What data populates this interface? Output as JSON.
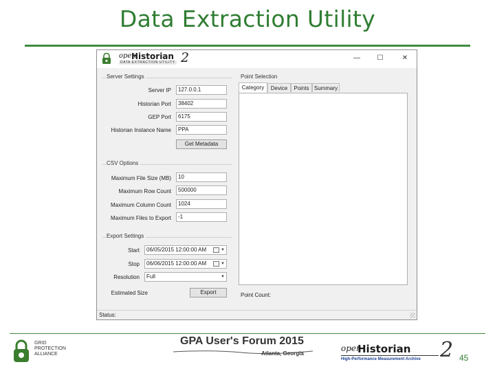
{
  "slide": {
    "title": "Data Extraction Utility",
    "page_number": "45"
  },
  "window": {
    "logo_open": "open",
    "logo_historian": "Historian",
    "logo_version": "2",
    "logo_subtitle": "DATA EXTRACTION UTILITY",
    "controls": {
      "minimize": "—",
      "maximize": "☐",
      "close": "✕"
    }
  },
  "server_settings": {
    "label": "Server Settings",
    "server_ip_label": "Server IP",
    "server_ip_value": "127.0.0.1",
    "historian_port_label": "Historian Port",
    "historian_port_value": "38402",
    "gep_port_label": "GEP Port",
    "gep_port_value": "6175",
    "instance_name_label": "Historian Instance Name",
    "instance_name_value": "PPA",
    "get_metadata_button": "Get Metadata"
  },
  "csv_options": {
    "label": "CSV Options",
    "max_file_size_label": "Maximum File Size (MB)",
    "max_file_size_value": "10",
    "max_row_count_label": "Maximum Row Count",
    "max_row_count_value": "500000",
    "max_column_count_label": "Maximum Column Count",
    "max_column_count_value": "1024",
    "max_files_label": "Maximum Files to Export",
    "max_files_value": "-1"
  },
  "export_settings": {
    "label": "Export Settings",
    "start_label": "Start",
    "start_value": "06/05/2015 12:00:00 AM",
    "stop_label": "Stop",
    "stop_value": "06/06/2015 12:00:00 AM",
    "resolution_label": "Resolution",
    "resolution_value": "Full",
    "estimated_size_label": "Estimated Size",
    "export_button": "Export"
  },
  "point_selection": {
    "label": "Point Selection",
    "tabs": [
      "Category",
      "Device",
      "Points",
      "Summary"
    ],
    "active_tab": "Category",
    "point_count_label": "Point Count:"
  },
  "status_bar": {
    "label": "Status:"
  },
  "footer": {
    "gpa_line1": "GRID",
    "gpa_line2": "PROTECTION",
    "gpa_line3": "ALLIANCE",
    "forum_title": "GPA User's Forum 2015",
    "forum_location": "Atlanta, Georgia",
    "oh_open": "open",
    "oh_historian": "Historian",
    "oh_version": "2",
    "oh_tagline": "High-Performance Measurement Archive"
  },
  "colors": {
    "accent_green": "#2f7d32",
    "window_bg": "#f0f0f0"
  }
}
